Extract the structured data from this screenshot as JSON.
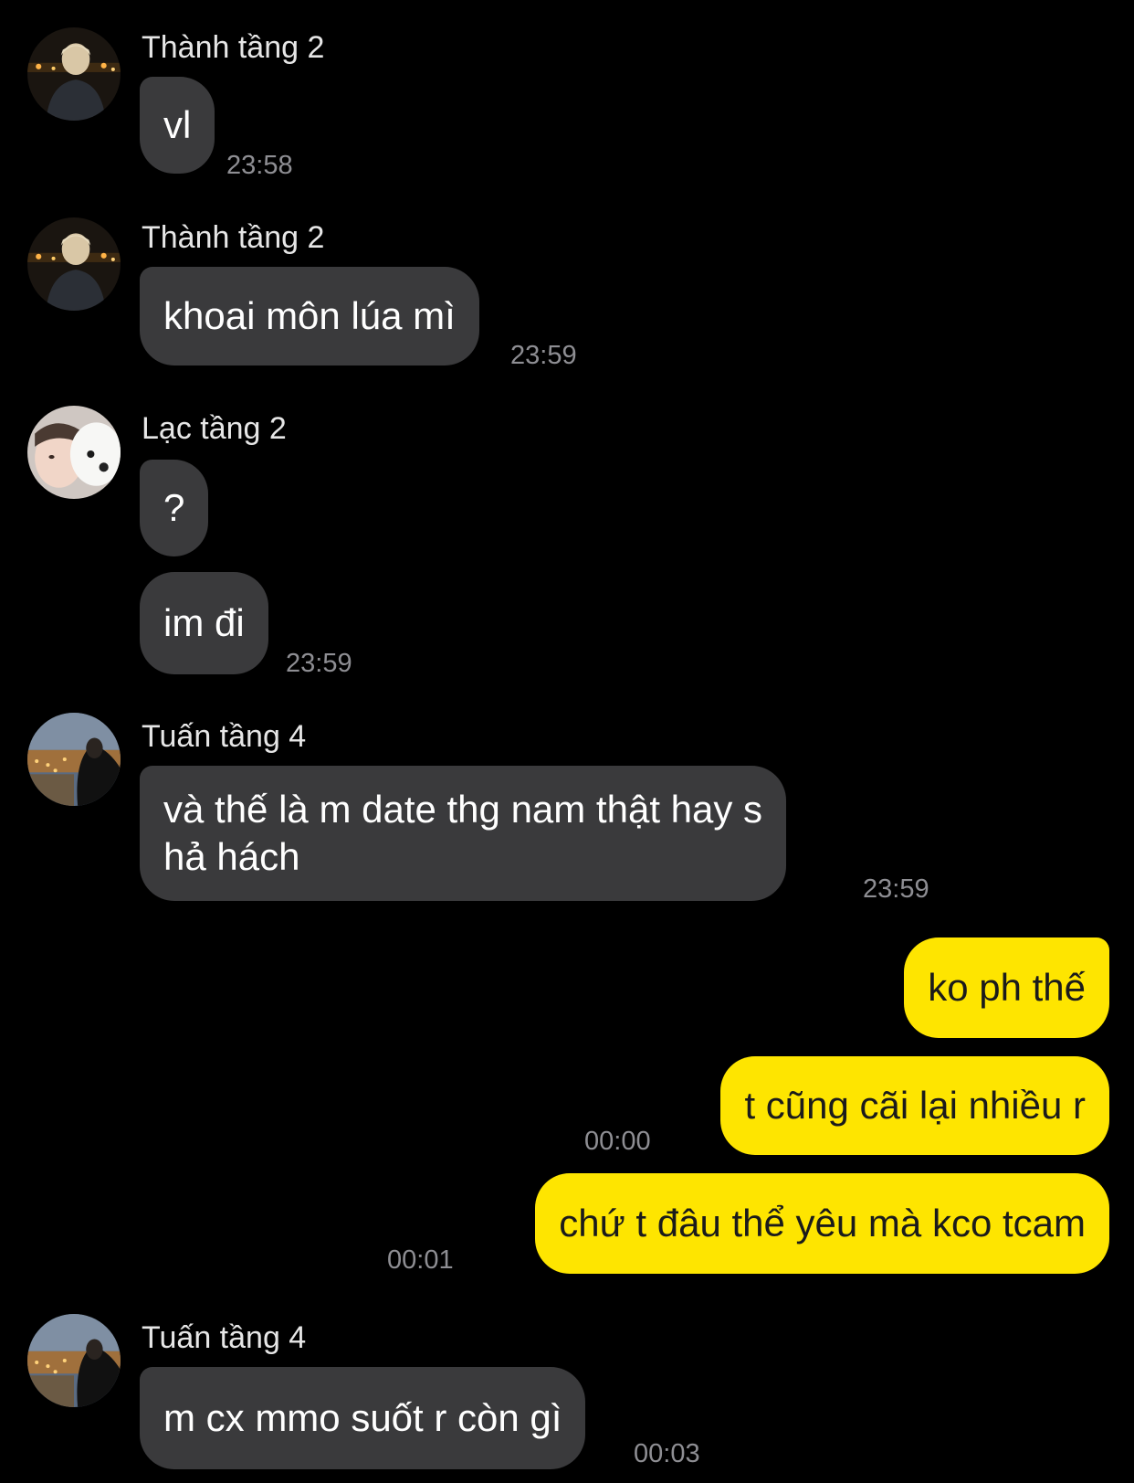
{
  "messages": [
    {
      "sender": "Thành tầng 2",
      "text": "vl",
      "time": "23:58"
    },
    {
      "sender": "Thành tầng 2",
      "text": "khoai môn lúa mì",
      "time": "23:59"
    },
    {
      "sender": "Lạc tầng 2",
      "text1": "?",
      "text2": "im đi",
      "time": "23:59"
    },
    {
      "sender": "Tuấn tầng 4",
      "line1": "và thế là m date thg nam thật hay s",
      "line2": "hả hách",
      "time": "23:59"
    },
    {
      "outgoing": true,
      "text": "ko ph thế"
    },
    {
      "outgoing": true,
      "text": "t cũng cãi lại nhiều r",
      "time": "00:00"
    },
    {
      "outgoing": true,
      "text": "chứ t đâu thể yêu mà kco tcam",
      "time": "00:01"
    },
    {
      "sender": "Tuấn tầng 4",
      "text": "m cx mmo suốt r còn gì",
      "time": "00:03"
    }
  ],
  "colors": {
    "background": "#000000",
    "incoming_bubble": "#3a3a3c",
    "outgoing_bubble": "#fee500",
    "timestamp": "#8e8e93"
  }
}
